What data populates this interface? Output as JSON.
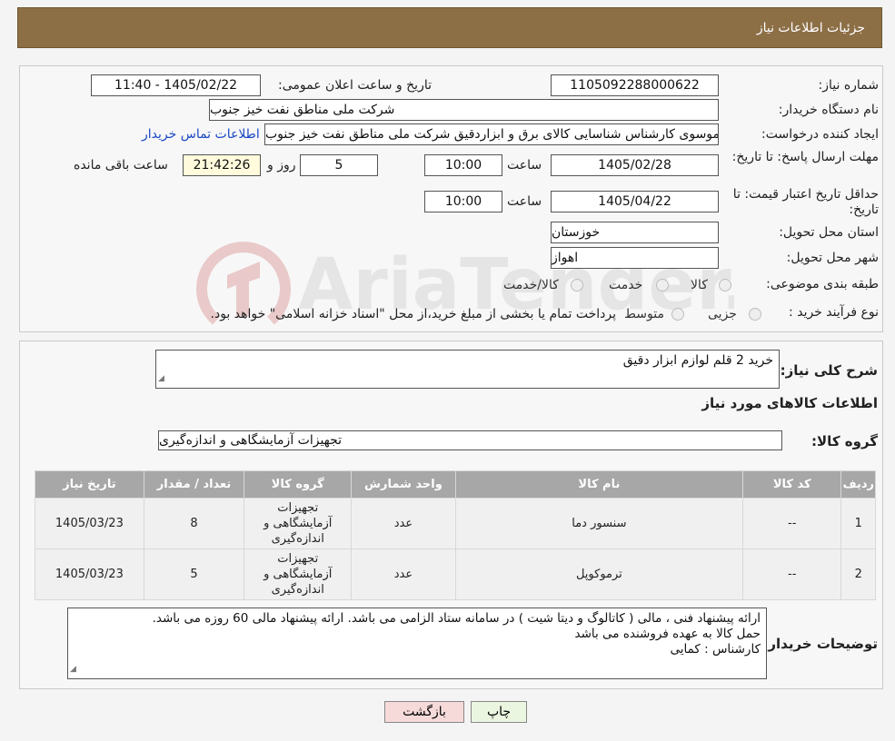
{
  "header": {
    "title": "جزئیات اطلاعات نیاز"
  },
  "form": {
    "need_number_label": "شماره نیاز:",
    "need_number": "1105092288000622",
    "announce_label": "تاریخ و ساعت اعلان عمومی:",
    "announce_value": "1405/02/22 - 11:40",
    "buyer_org_label": "نام دستگاه خریدار:",
    "buyer_org": "شرکت ملی مناطق نفت خیز جنوب",
    "creator_label": "ایجاد کننده درخواست:",
    "creator": "سیدمحمد موسوی کارشناس شناسایی کالای برق و ابزاردقیق شرکت ملی مناطق نفت خیز جنوب",
    "contact_link": "اطلاعات تماس خریدار",
    "deadline_label": "مهلت ارسال پاسخ: تا تاریخ:",
    "deadline_date": "1405/02/28",
    "time_label": "ساعت",
    "deadline_time": "10:00",
    "days_value": "5",
    "days_label": "روز و",
    "timer_value": "21:42:26",
    "remaining_label": "ساعت باقی مانده",
    "validity_label": "حداقل تاریخ اعتبار قیمت: تا تاریخ:",
    "validity_date": "1405/04/22",
    "validity_time": "10:00",
    "province_label": "استان محل تحویل:",
    "province": "خوزستان",
    "city_label": "شهر محل تحویل:",
    "city": "اهواز",
    "category_label": "طبقه بندی موضوعی:",
    "category_options": [
      "کالا",
      "خدمت",
      "کالا/خدمت"
    ],
    "process_label": "نوع فرآیند خرید :",
    "process_options": [
      "جزیی",
      "متوسط"
    ],
    "process_note": "پرداخت تمام یا بخشی از مبلغ خرید،از محل \"اسناد خزانه اسلامی\" خواهد بود."
  },
  "watermark": {
    "text": "AriaTender.neT"
  },
  "summary": {
    "desc_label": "شرح کلی نیاز:",
    "desc_value": "خرید 2 قلم لوازم ابزار دقیق",
    "items_title": "اطلاعات کالاهای مورد نیاز",
    "group_label": "گروه کالا:",
    "group_value": "تجهیزات آزمایشگاهی و اندازه‌گیری"
  },
  "table": {
    "headers": [
      "ردیف",
      "کد کالا",
      "نام کالا",
      "واحد شمارش",
      "گروه کالا",
      "تعداد / مقدار",
      "تاریخ نیاز"
    ],
    "rows": [
      {
        "row": "1",
        "code": "--",
        "name": "سنسور دما",
        "unit": "عدد",
        "group": "تجهیزات آزمایشگاهی و اندازه‌گیری",
        "qty": "8",
        "date": "1405/03/23"
      },
      {
        "row": "2",
        "code": "--",
        "name": "ترموکوپل",
        "unit": "عدد",
        "group": "تجهیزات آزمایشگاهی و اندازه‌گیری",
        "qty": "5",
        "date": "1405/03/23"
      }
    ]
  },
  "buyer_notes": {
    "label": "توضیحات خریدار:",
    "line1": "ارائه پیشنهاد فنی ، مالی ( کاتالوگ و دیتا شیت ) در سامانه ستاد الزامی می باشد. ارائه پیشنهاد مالی 60 روزه می باشد.",
    "line2": "حمل کالا به عهده فروشنده می باشد",
    "line3": "کارشناس : کمایی"
  },
  "buttons": {
    "print": "چاپ",
    "back": "بازگشت"
  },
  "colors": {
    "header_bg": "#8d6f46",
    "link": "#1a48c4",
    "table_header": "#a7a7a7",
    "back_btn": "#f6dada",
    "print_btn": "#eaf6e0"
  }
}
